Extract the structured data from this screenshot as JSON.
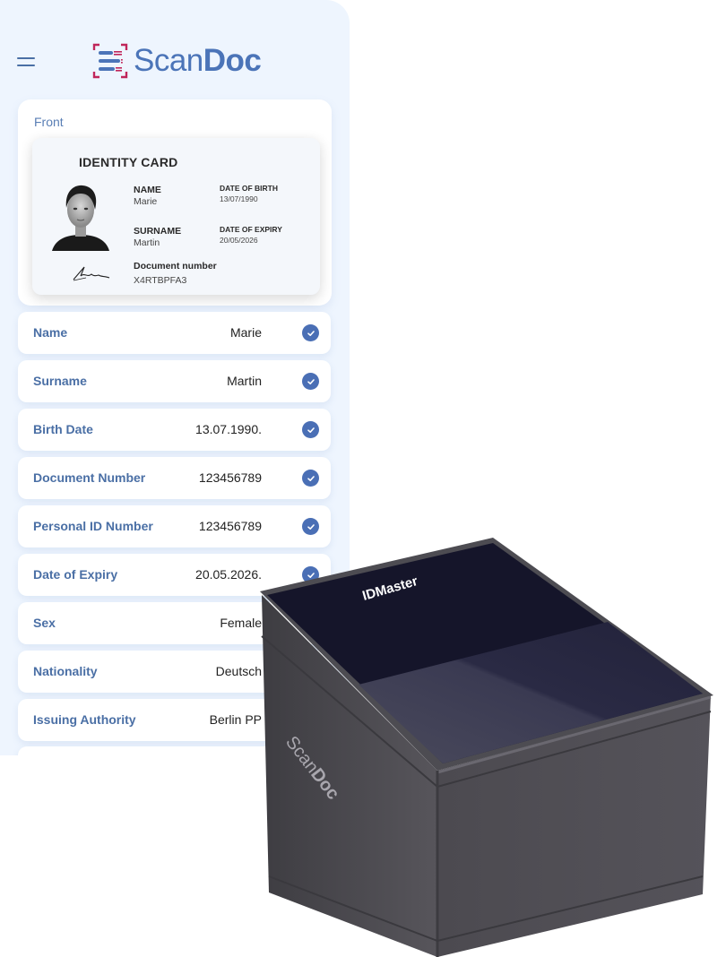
{
  "header": {
    "menu_icon": "hamburger-icon",
    "logo": {
      "icon": "scan-document-icon",
      "text_light": "Scan",
      "text_bold": "Doc"
    }
  },
  "front_section": {
    "label": "Front",
    "id_card": {
      "title": "IDENTITY CARD",
      "photo": "portrait-photo",
      "signature": "signature-image",
      "fields": {
        "name_label": "NAME",
        "name_value": "Marie",
        "surname_label": "SURNAME",
        "surname_value": "Martin",
        "dob_label": "DATE OF BIRTH",
        "dob_value": "13/07/1990",
        "doe_label": "DATE OF EXPIRY",
        "doe_value": "20/05/2026",
        "docnum_label": "Document number",
        "docnum_value": "X4RTBPFA3"
      }
    }
  },
  "fields": [
    {
      "label": "Name",
      "value": "Marie",
      "verified": true
    },
    {
      "label": "Surname",
      "value": "Martin",
      "verified": true
    },
    {
      "label": "Birth Date",
      "value": "13.07.1990.",
      "verified": true
    },
    {
      "label": "Document Number",
      "value": "123456789",
      "verified": true
    },
    {
      "label": "Personal ID Number",
      "value": "123456789",
      "verified": true
    },
    {
      "label": "Date of Expiry",
      "value": "20.05.2026.",
      "verified": true
    },
    {
      "label": "Sex",
      "value": "Female",
      "verified": null
    },
    {
      "label": "Nationality",
      "value": "Deutsch",
      "verified": null
    },
    {
      "label": "Issuing Authority",
      "value": "Berlin PP",
      "verified": null
    }
  ],
  "device": {
    "top_label": "IDMaster",
    "side_brand_light": "Scan",
    "side_brand_bold": "Doc"
  },
  "colors": {
    "accent": "#4a6fb5",
    "logo_red": "#c0265a",
    "panel_bg": "#eef5fe",
    "device_body": "#4a4a50",
    "device_top": "#15152a"
  }
}
